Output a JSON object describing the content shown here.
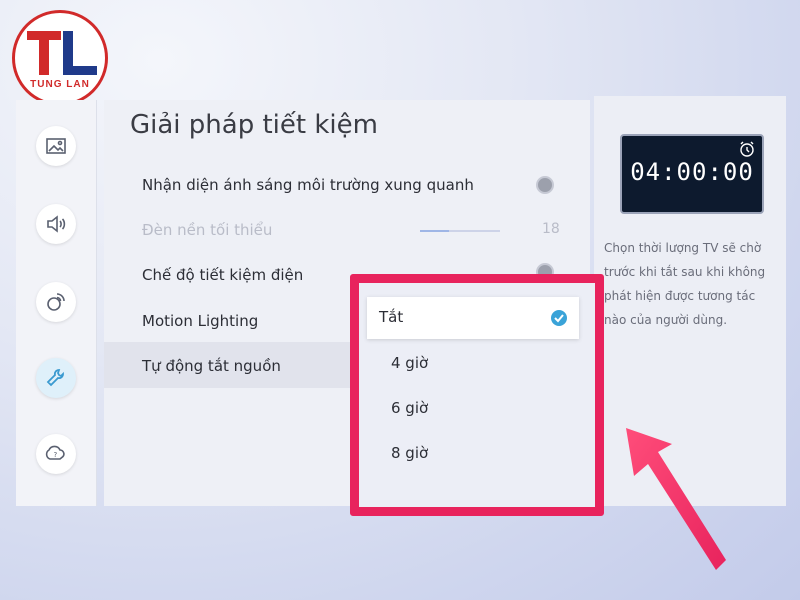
{
  "logo": {
    "brand": "TUNG LAN",
    "color": "#d12a2a"
  },
  "sidebar": {
    "items": [
      {
        "icon": "picture-icon"
      },
      {
        "icon": "sound-icon"
      },
      {
        "icon": "broadcast-icon"
      },
      {
        "icon": "wrench-icon",
        "active": true
      },
      {
        "icon": "support-icon"
      }
    ]
  },
  "main": {
    "title": "Giải pháp tiết kiệm",
    "rows": [
      {
        "label": "Nhận diện ánh sáng môi trường xung quanh",
        "control": "toggle"
      },
      {
        "label": "Đèn nền tối thiểu",
        "disabled": true,
        "slider_value": 18
      },
      {
        "label": "Chế độ tiết kiệm điện",
        "control": "toggle"
      },
      {
        "label": "Motion Lighting"
      },
      {
        "label": "Tự động tắt nguồn",
        "highlighted": true
      }
    ]
  },
  "info": {
    "clock_time": "04:00:00",
    "description": "Chọn thời lượng TV sẽ chờ trước khi tắt sau khi không phát hiện được tương tác nào của người dùng."
  },
  "dropdown": {
    "highlight_color": "#e8235d",
    "options": [
      {
        "label": "Tắt",
        "selected": true
      },
      {
        "label": "4 giờ"
      },
      {
        "label": "6 giờ"
      },
      {
        "label": "8 giờ"
      }
    ]
  },
  "annotation": {
    "arrow_color": "#e8235d"
  }
}
